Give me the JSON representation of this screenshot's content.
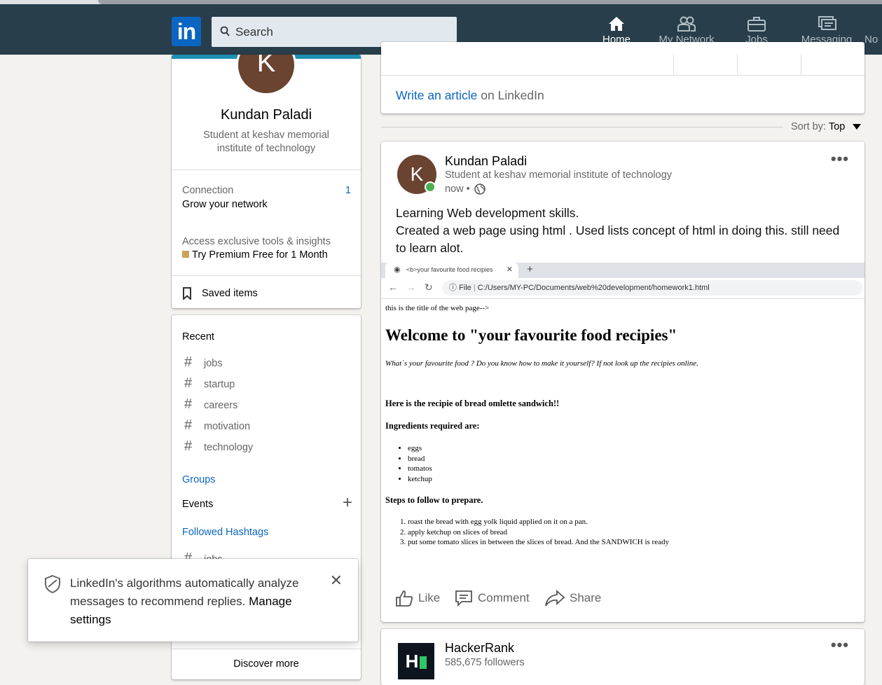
{
  "nav": {
    "search_placeholder": "Search",
    "items": [
      {
        "label": "Home",
        "icon": "home-icon",
        "active": true
      },
      {
        "label": "My Network",
        "icon": "network-icon",
        "active": false
      },
      {
        "label": "Jobs",
        "icon": "briefcase-icon",
        "active": false
      },
      {
        "label": "Messaging",
        "icon": "messaging-icon",
        "active": false
      },
      {
        "label": "No",
        "icon": "notifications-icon",
        "active": false
      }
    ],
    "logo_text": "in"
  },
  "profile": {
    "initial": "K",
    "name": "Kundan Paladi",
    "headline": "Student at keshav memorial institute of technology",
    "connection_label": "Connection",
    "connection_count": "1",
    "grow_label": "Grow your network",
    "premium_note": "Access exclusive tools & insights",
    "premium_cta": "Try Premium Free for 1 Month",
    "saved_items": "Saved items"
  },
  "sidebar": {
    "recent_title": "Recent",
    "recent": [
      "jobs",
      "startup",
      "careers",
      "motivation",
      "technology"
    ],
    "groups_label": "Groups",
    "events_label": "Events",
    "followed_label": "Followed Hashtags",
    "followed_first": "jobs",
    "discover_more": "Discover more"
  },
  "toast": {
    "text": "LinkedIn's algorithms automatically analyze messages to recommend replies.",
    "link": "Manage settings"
  },
  "composer": {
    "write_article": "Write an article",
    "on_linkedin": " on LinkedIn"
  },
  "feed": {
    "sort_label": "Sort by:",
    "sort_value": "Top"
  },
  "post": {
    "author": "Kundan Paladi",
    "headline": "Student at keshav memorial institute of technology",
    "time": "now •",
    "line1": "Learning Web development skills.",
    "line2": "Created a web page using html .  Used lists concept of html in doing this. still need to learn alot.",
    "like": "Like",
    "comment": "Comment",
    "share": "Share"
  },
  "screenshot": {
    "tab_title": "<b>your favourite food recipies",
    "file_label": "File",
    "url": "C:/Users/MY-PC/Documents/web%20development/homework1.html",
    "title_comment": "this is the title of the web page-->",
    "heading": "Welcome to \"your favourite food recipies\"",
    "tagline": "What`s your favourite food ? Do you know how to make it yourself? If not look up the recipies online.",
    "recipe_heading": "Here is the recipie of bread omlette sandwich!!",
    "ingredients_heading": "Ingredients required are:",
    "ingredients": [
      "eggs",
      "bread",
      "tomatos",
      "ketchup"
    ],
    "steps_heading": "Steps to follow to prepare.",
    "steps": [
      "roast the bread with egg yolk liquid applied on it on a pan.",
      "apply ketchup on slices of bread",
      "put some tomato slices in between the slices of bread. And the SANDWICH is ready"
    ]
  },
  "company_post": {
    "name": "HackerRank",
    "followers": "585,675 followers"
  },
  "colors": {
    "navbar": "#283e4a",
    "link": "#0a66c2",
    "avatar": "#6b4331",
    "online": "#4caf50"
  }
}
